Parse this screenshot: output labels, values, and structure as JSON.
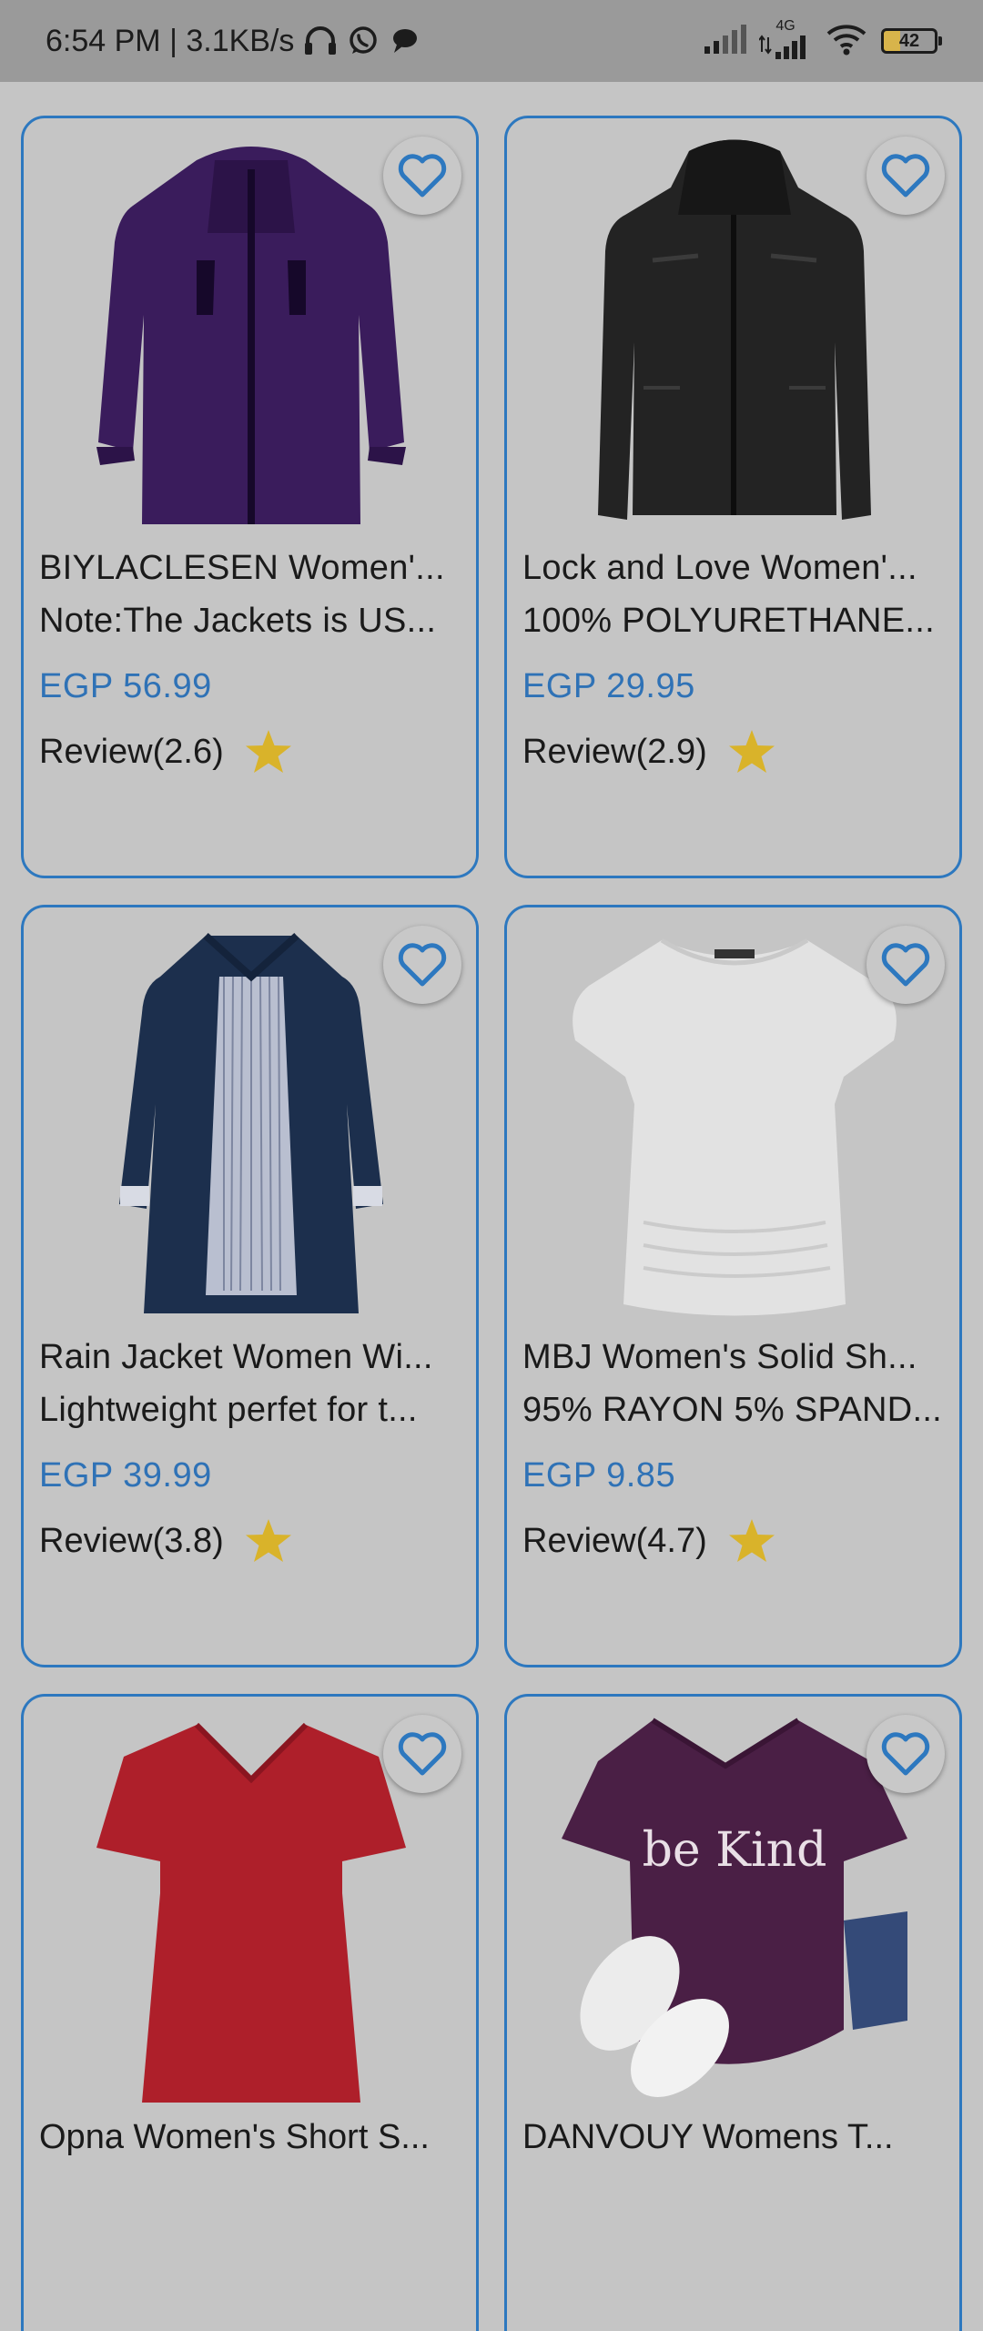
{
  "status_bar": {
    "time": "6:54 PM | 3.1KB/s",
    "network": "4G",
    "battery": "42"
  },
  "products": [
    {
      "title": "BIYLACLESEN Women'...",
      "description": "Note:The Jackets is US...",
      "price": "EGP 56.99",
      "review": "Review(2.6)",
      "image": "purple-jacket",
      "color": "#3d1f5f"
    },
    {
      "title": "Lock and Love Women'...",
      "description": "100% POLYURETHANE...",
      "price": "EGP 29.95",
      "review": "Review(2.9)",
      "image": "black-leather-jacket",
      "color": "#262626"
    },
    {
      "title": "Rain Jacket Women Wi...",
      "description": "Lightweight perfet for t...",
      "price": "EGP 39.99",
      "review": "Review(3.8)",
      "image": "navy-rain-jacket",
      "color": "#1d3150"
    },
    {
      "title": "MBJ Women's Solid Sh...",
      "description": "95% RAYON 5% SPAND...",
      "price": "EGP 9.85",
      "review": "Review(4.7)",
      "image": "white-tshirt",
      "color": "#e4e4e4"
    },
    {
      "title": "Opna Women's Short S...",
      "image": "red-tshirt",
      "color": "#b0202b"
    },
    {
      "title": "DANVOUY Womens T...",
      "image": "be-kind-tshirt",
      "image_text": "be Kind",
      "color": "#4a1f45"
    }
  ],
  "colors": {
    "accent": "#2d78bf",
    "price": "#2f72b6",
    "star": "#d9b32a",
    "background": "#c5c5c5"
  }
}
